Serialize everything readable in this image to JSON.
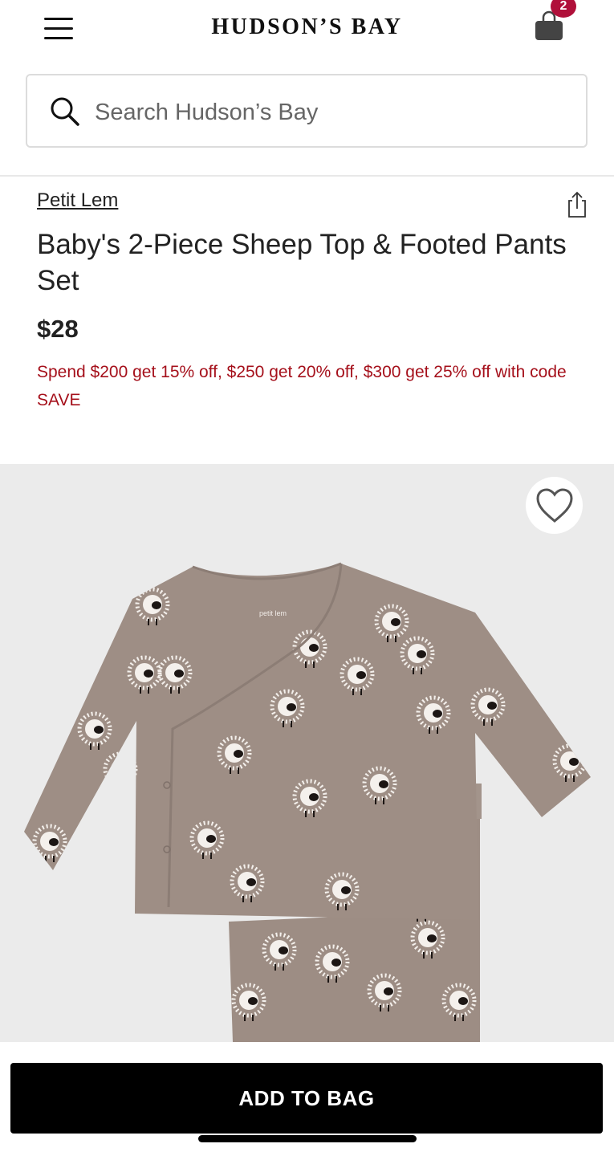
{
  "header": {
    "brand": "HUDSON’S BAY",
    "bag_count": "2",
    "menu_icon": "hamburger-menu-icon",
    "bag_icon": "shopping-bag-icon"
  },
  "search": {
    "placeholder": "Search Hudson’s Bay",
    "icon": "search-icon"
  },
  "product": {
    "brand": "Petit Lem",
    "title": "Baby's 2-Piece Sheep Top & Footed Pants Set",
    "price": "$28",
    "promo": "Spend $200 get 15% off, $250 get 20% off, $300 get 25% off with code SAVE",
    "image_label": "petit lem"
  },
  "actions": {
    "add_to_bag": "ADD TO BAG",
    "share_icon": "share-icon",
    "wishlist_icon": "heart-icon"
  },
  "colors": {
    "promo": "#a5101b",
    "badge": "#b0103a",
    "button": "#000000",
    "garment": "#9e8e85"
  }
}
